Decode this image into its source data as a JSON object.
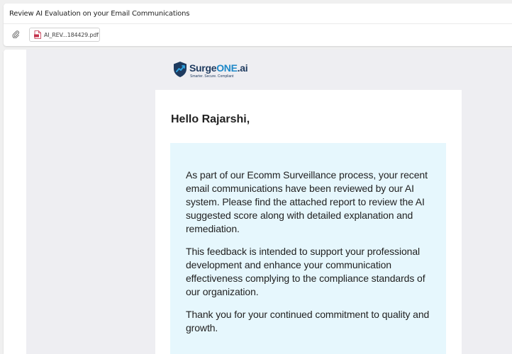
{
  "email": {
    "subject": "Review AI Evaluation on your Email Communications",
    "attachment": {
      "name": "AI_REV...184429.pdf",
      "icon": "pdf-file-icon"
    }
  },
  "logo": {
    "part1": "Surge",
    "part2": "ONE",
    "part3": ".ai",
    "tagline": "Smarter. Secure. Compliant",
    "colors": {
      "navy": "#1e3a5f",
      "blue": "#1e88c8"
    }
  },
  "message": {
    "greeting": "Hello Rajarshi,",
    "paragraphs": [
      "As part of our Ecomm Surveillance process, your recent email communications have been reviewed by our AI system. Please find the attached report to review the AI suggested score along with detailed explanation and remediation.",
      "This feedback is intended to support your professional development and enhance your communication effectiveness complying to the compliance standards of our organization.",
      "Thank you for your continued commitment to quality and growth."
    ],
    "box_color": "#e6f7fd"
  }
}
